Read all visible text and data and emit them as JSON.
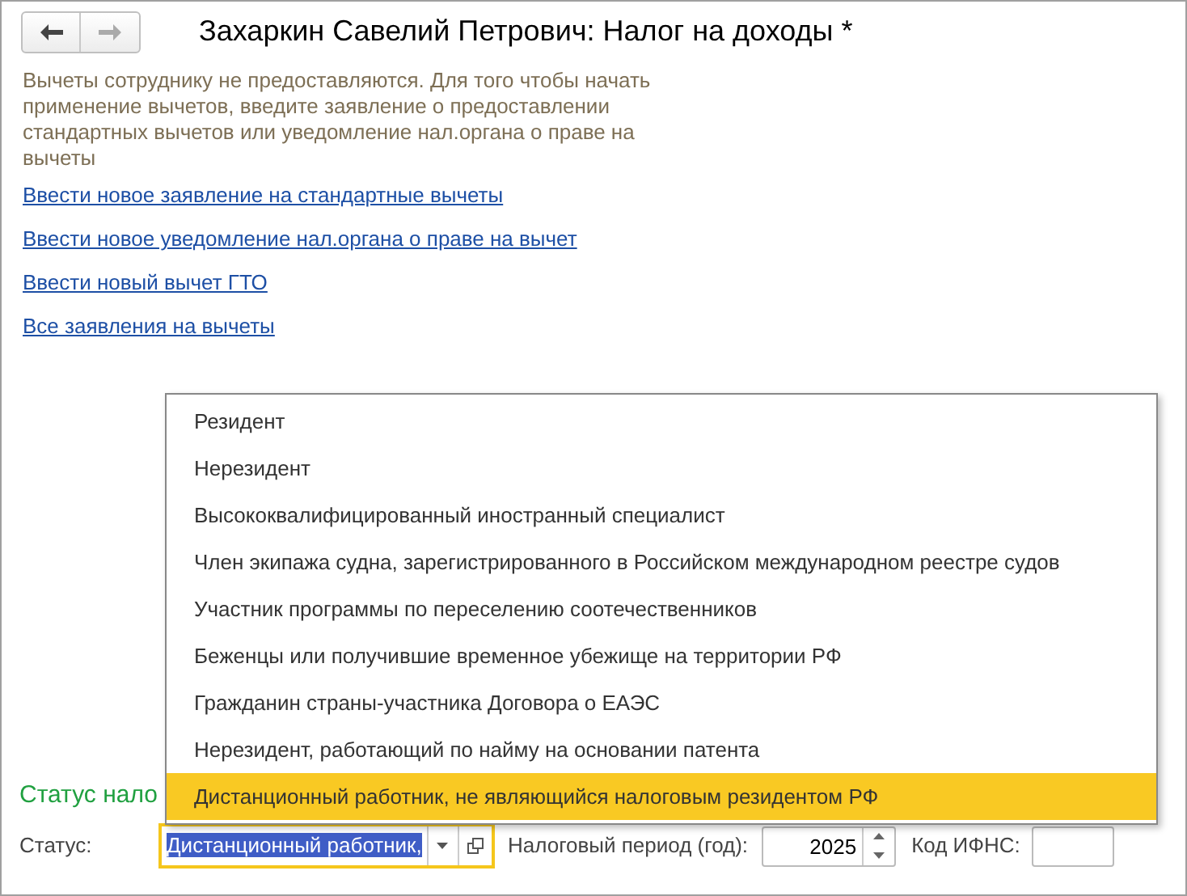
{
  "window": {
    "title": "Захаркин Савелий Петрович: Налог на доходы *"
  },
  "info_text": "Вычеты сотруднику не предоставляются. Для того чтобы начать применение вычетов, введите заявление о предоставлении стандартных вычетов или уведомление нал.органа о праве на вычеты",
  "links": [
    "Ввести новое заявление на стандартные вычеты",
    "Ввести новое уведомление нал.органа о праве на вычет",
    "Ввести новый вычет ГТО",
    "Все заявления на вычеты"
  ],
  "section_title": "Статус нало",
  "status_row": {
    "status_label": "Статус:",
    "status_value": "Дистанционный работник,",
    "period_label": "Налоговый период (год):",
    "period_value": "2025",
    "ifns_label": "Код ИФНС:"
  },
  "dropdown": [
    {
      "label": "Резидент",
      "selected": false
    },
    {
      "label": "Нерезидент",
      "selected": false
    },
    {
      "label": "Высококвалифицированный иностранный специалист",
      "selected": false
    },
    {
      "label": "Член экипажа судна, зарегистрированного в Российском международном реестре судов",
      "selected": false
    },
    {
      "label": "Участник программы по переселению соотечественников",
      "selected": false
    },
    {
      "label": "Беженцы или получившие временное убежище на территории РФ",
      "selected": false
    },
    {
      "label": "Гражданин страны-участника Договора о ЕАЭС",
      "selected": false
    },
    {
      "label": "Нерезидент, работающий по найму на основании патента",
      "selected": false
    },
    {
      "label": "Дистанционный работник, не являющийся налоговым резидентом РФ",
      "selected": true
    }
  ]
}
